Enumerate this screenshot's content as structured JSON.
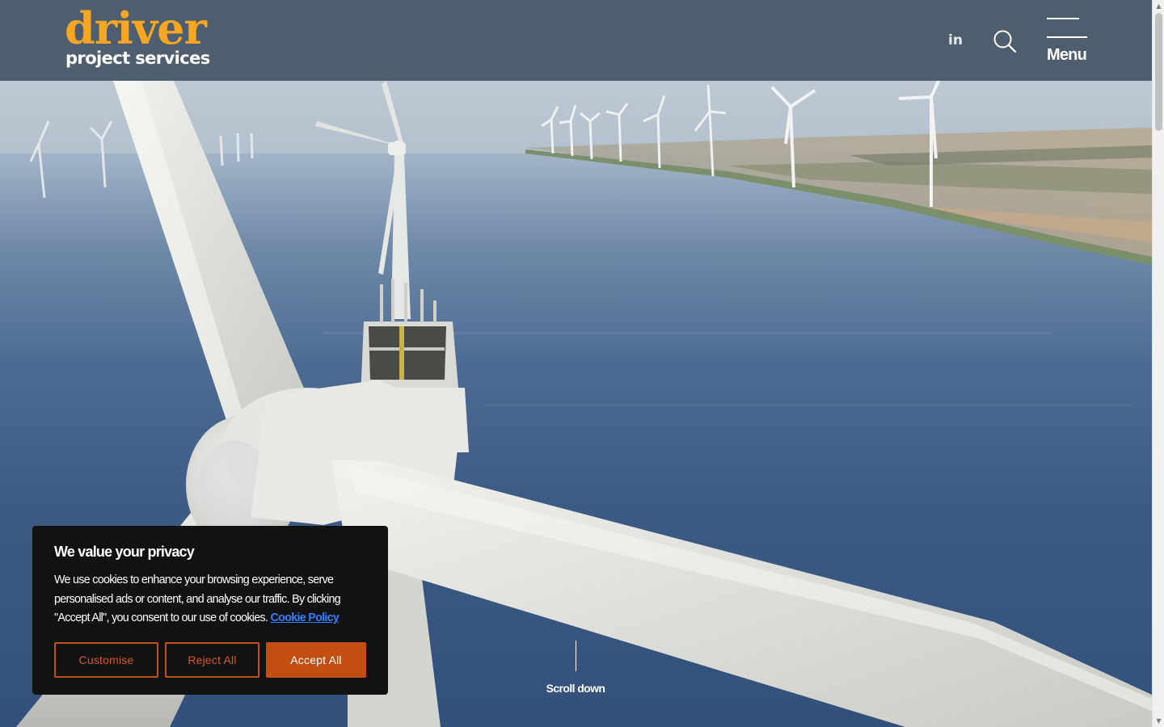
{
  "header": {
    "logo_main": "driver",
    "logo_sub": "project services",
    "linkedin_label": "in",
    "menu_label": "Menu"
  },
  "hero": {
    "scroll_label": "Scroll down"
  },
  "cookie_banner": {
    "title": "We value your privacy",
    "text": "We use cookies to enhance your browsing experience, serve personalised ads or content, and analyse our traffic. By clicking \"Accept All\", you consent to our use of cookies.",
    "link_label": "Cookie Policy",
    "buttons": {
      "customise": "Customise",
      "reject": "Reject All",
      "accept": "Accept All"
    }
  },
  "colors": {
    "brand_orange": "#f5a623",
    "accent_button": "#c24e12",
    "header_bg": "#4a5a6a",
    "link_blue": "#2f80ff"
  },
  "icons": {
    "linkedin": "linkedin-icon",
    "search": "search-icon",
    "menu": "hamburger-icon",
    "scroll": "scroll-line-icon"
  }
}
